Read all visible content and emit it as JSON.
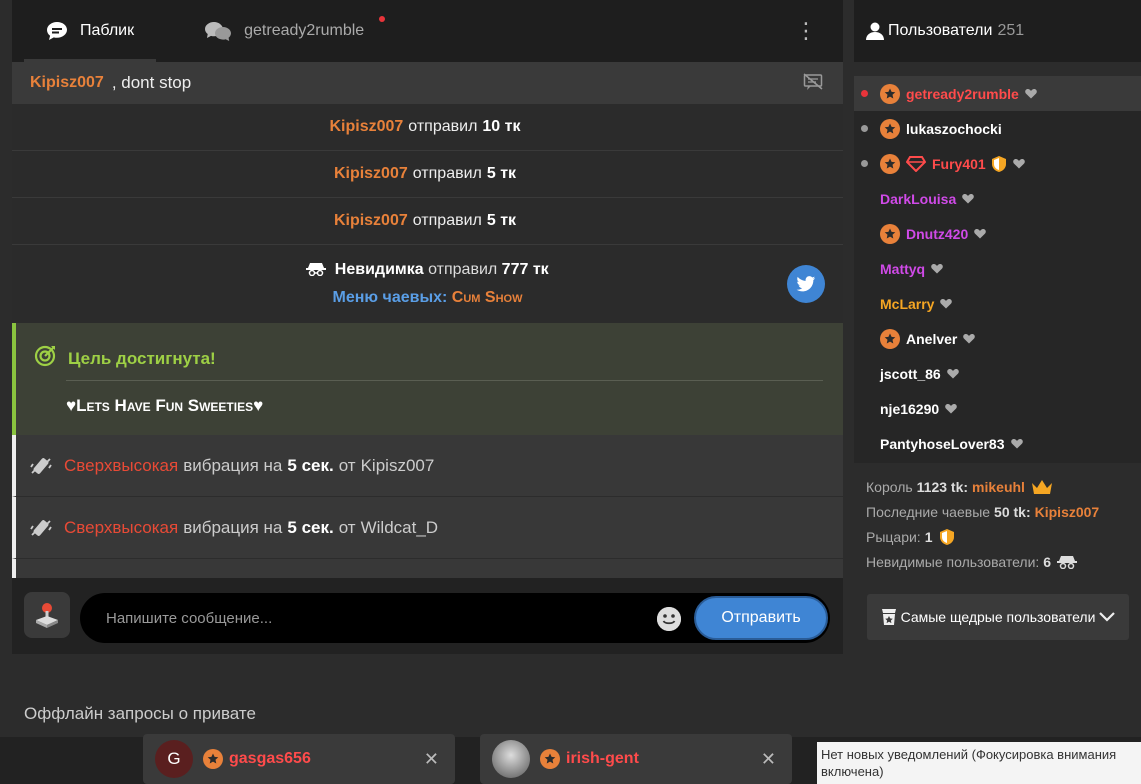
{
  "chat": {
    "tabs": [
      {
        "label": "Паблик",
        "active": true
      },
      {
        "label": "getready2rumble",
        "active": false,
        "unread": true
      }
    ],
    "pinned": {
      "nick": "Kipisz007",
      "text": ", dont stop"
    },
    "tips": [
      {
        "nick": "Kipisz007",
        "action": "отправил",
        "amount": "10 тк"
      },
      {
        "nick": "Kipisz007",
        "action": "отправил",
        "amount": "5 тк"
      },
      {
        "nick": "Kipisz007",
        "action": "отправил",
        "amount": "5 тк"
      }
    ],
    "anon_tip": {
      "nick": "Невидимка",
      "action": "отправил",
      "amount": "777 тк",
      "menu_label": "Меню чаевых:",
      "menu_value": "Cum Show"
    },
    "goal": {
      "title": "Цель достигнута!",
      "text": "♥Lets Have Fun Sweeties♥"
    },
    "vibrations": [
      {
        "level": "Сверхвысокая",
        "label": "вибрация на",
        "duration": "5 сек.",
        "from_label": "от",
        "user": "Kipisz007"
      },
      {
        "level": "Сверхвысокая",
        "label": "вибрация на",
        "duration": "5 сек.",
        "from_label": "от",
        "user": "Wildcat_D"
      }
    ],
    "composer": {
      "placeholder": "Напишите сообщение...",
      "send_label": "Отправить"
    }
  },
  "users": {
    "title": "Пользователи",
    "count": "251",
    "list": [
      {
        "name": "getready2rumble",
        "color": "#ff4b4b",
        "status": "red",
        "star": true
      },
      {
        "name": "lukaszochocki",
        "color": "#ffffff",
        "status": "grey",
        "star": true
      },
      {
        "name": "Fury401",
        "color": "#ff4b4b",
        "status": "grey",
        "star": true
      },
      {
        "name": "DarkLouisa",
        "color": "#d04ae8",
        "status": "none",
        "star": false
      },
      {
        "name": "Dnutz420",
        "color": "#d04ae8",
        "status": "none",
        "star": true
      },
      {
        "name": "Mattyq",
        "color": "#d04ae8",
        "status": "none",
        "star": false
      },
      {
        "name": "McLarry",
        "color": "#f5a623",
        "status": "none",
        "star": false
      },
      {
        "name": "Anelver",
        "color": "#ffffff",
        "status": "none",
        "star": true
      },
      {
        "name": "jscott_86",
        "color": "#ffffff",
        "status": "none",
        "star": false
      },
      {
        "name": "nje16290",
        "color": "#ffffff",
        "status": "none",
        "star": false
      },
      {
        "name": "PantyhoseLover83",
        "color": "#ffffff",
        "status": "none",
        "star": false
      }
    ],
    "stats": {
      "king_label": "Король",
      "king_amount": "1123 tk:",
      "king_user": "mikeuhl",
      "last_label": "Последние чаевые",
      "last_amount": "50 tk:",
      "last_user": "Kipisz007",
      "knights_label": "Рыцари:",
      "knights_count": "1",
      "invisible_label": "Невидимые пользователи:",
      "invisible_count": "6"
    },
    "generous_label": "Самые щедрые пользователи"
  },
  "offline": {
    "title": "Оффлайн запросы о привате",
    "requests": [
      {
        "avatar_letter": "G",
        "name": "gasgas656"
      },
      {
        "avatar_letter": "",
        "name": "irish-gent"
      }
    ]
  },
  "toast": {
    "text": "Нет новых уведомлений (Фокусировка внимания включена)"
  },
  "colors": {
    "accent": "#3f85d4",
    "nick": "#e8813a",
    "goal": "#9ed045",
    "danger": "#e84a36"
  }
}
